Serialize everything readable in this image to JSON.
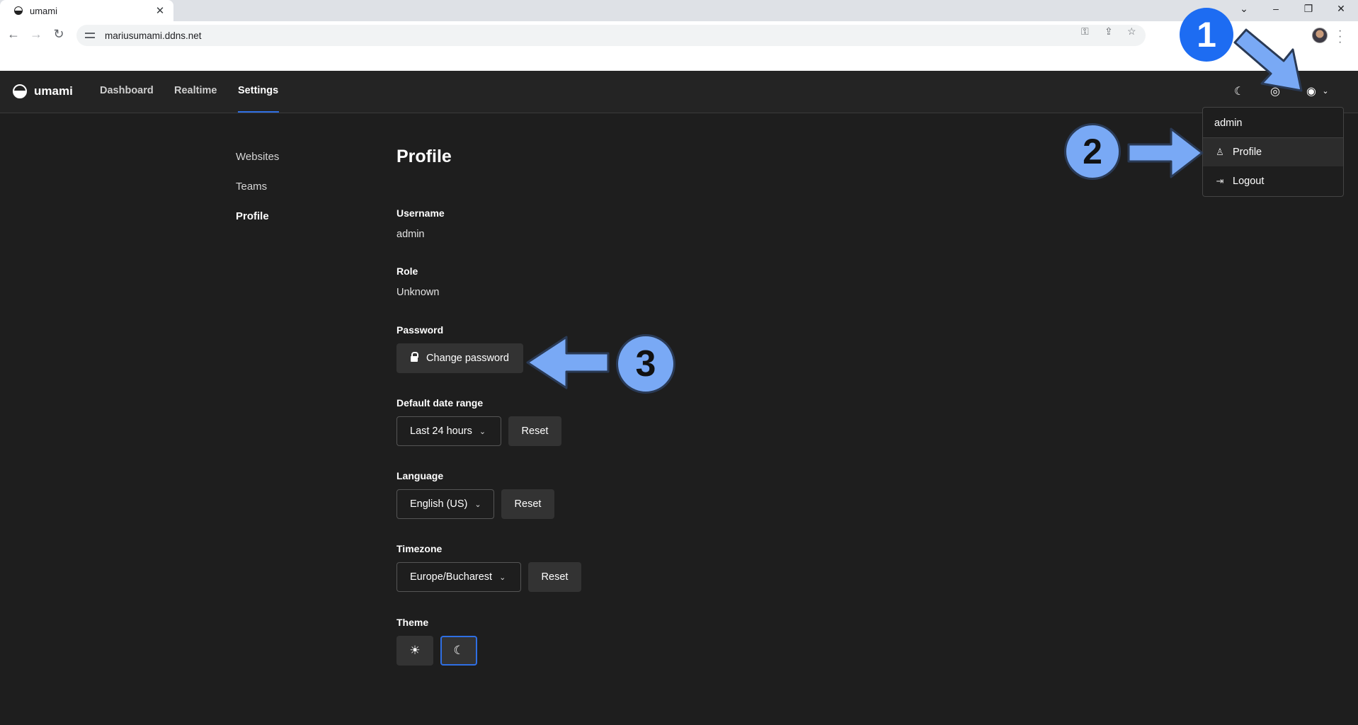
{
  "browser": {
    "tab_title": "umami",
    "tab_close": "✕",
    "url": "mariusumami.ddns.net",
    "window_controls": [
      "⌄",
      "–",
      "❐",
      "✕"
    ],
    "nav_icons": [
      "arrow-left-icon",
      "arrow-right-icon",
      "reload-icon"
    ],
    "omnibox_icons": [
      "key-icon",
      "share-icon",
      "star-icon"
    ]
  },
  "header": {
    "brand": "umami",
    "nav": [
      "Dashboard",
      "Realtime",
      "Settings"
    ],
    "active_nav": "Settings",
    "icons": [
      "moon-icon",
      "globe-icon",
      "user-circle-icon",
      "chevron-down-icon"
    ]
  },
  "sidebar": {
    "items": [
      {
        "label": "Websites"
      },
      {
        "label": "Teams"
      },
      {
        "label": "Profile",
        "active": true
      }
    ]
  },
  "profile": {
    "title": "Profile",
    "username_label": "Username",
    "username_value": "admin",
    "role_label": "Role",
    "role_value": "Unknown",
    "password_label": "Password",
    "change_password": "Change password",
    "date_range_label": "Default date range",
    "date_range_value": "Last 24 hours",
    "language_label": "Language",
    "language_value": "English (US)",
    "timezone_label": "Timezone",
    "timezone_value": "Europe/Bucharest",
    "reset": "Reset",
    "theme_label": "Theme",
    "theme_light": "☀",
    "theme_dark": "☾"
  },
  "user_menu": {
    "username": "admin",
    "items": [
      "Profile",
      "Logout"
    ]
  },
  "annotations": {
    "badges": [
      "1",
      "2",
      "3"
    ],
    "colors": {
      "badge_blue": "#1d6cf2",
      "badge_light": "#79a9f5",
      "arrow": "#79a9f5",
      "accent": "#2f6fe4"
    }
  }
}
